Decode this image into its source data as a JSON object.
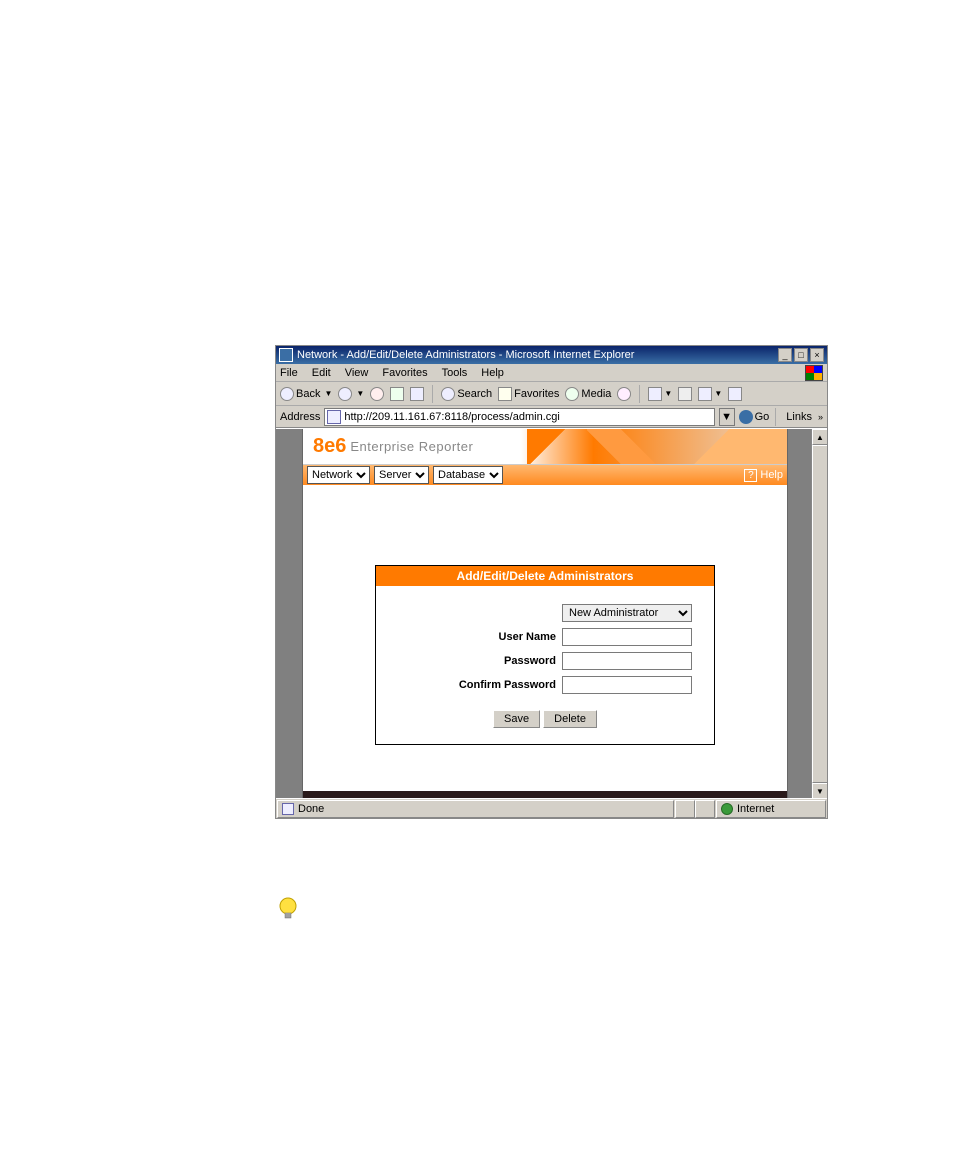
{
  "window": {
    "title": "Network - Add/Edit/Delete Administrators - Microsoft Internet Explorer"
  },
  "menubar": {
    "file": "File",
    "edit": "Edit",
    "view": "View",
    "favorites": "Favorites",
    "tools": "Tools",
    "help": "Help"
  },
  "toolbar": {
    "back": "Back",
    "search": "Search",
    "favorites": "Favorites",
    "media": "Media"
  },
  "address": {
    "label": "Address",
    "url": "http://209.11.161.67:8118/process/admin.cgi",
    "go": "Go",
    "links": "Links"
  },
  "brand": {
    "logo": "8e6",
    "product": "Enterprise Reporter"
  },
  "appmenu": {
    "network": "Network",
    "server": "Server",
    "database": "Database",
    "help": "Help"
  },
  "panel": {
    "title": "Add/Edit/Delete Administrators",
    "select_default": "New Administrator",
    "username_label": "User Name",
    "password_label": "Password",
    "confirm_label": "Confirm Password",
    "save": "Save",
    "delete": "Delete"
  },
  "status": {
    "done": "Done",
    "zone": "Internet"
  }
}
